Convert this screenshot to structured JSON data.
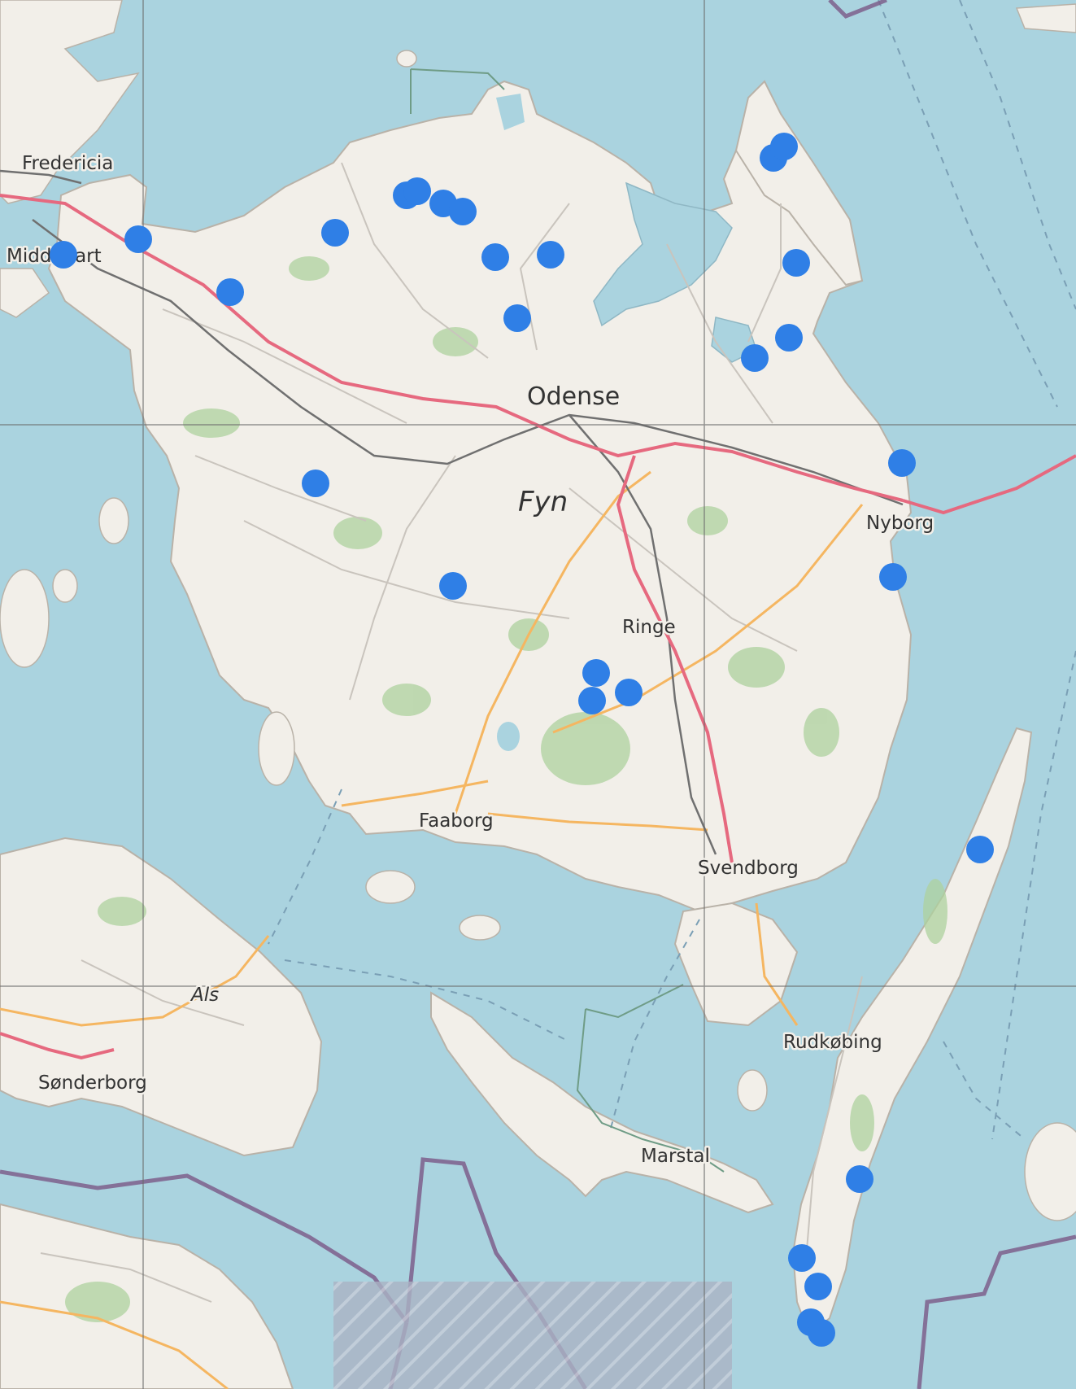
{
  "colors": {
    "water": "#aad3df",
    "land": "#f2efe9",
    "vegetation": "#add19e",
    "motorway": "#e6697f",
    "primary_road": "#f5b661",
    "minor_road": "#c9c4bd",
    "railway": "#707070",
    "boundary": "#7e5f8c",
    "ferry": "#7a9fb5",
    "grid_line": "#6b6b6b",
    "marker": "#2f7fe6"
  },
  "places": [
    {
      "id": "fredericia",
      "label": "Fredericia"
    },
    {
      "id": "middelfart",
      "label": "Middelfart"
    },
    {
      "id": "odense",
      "label": "Odense"
    },
    {
      "id": "fyn",
      "label": "Fyn"
    },
    {
      "id": "nyborg",
      "label": "Nyborg"
    },
    {
      "id": "ringe",
      "label": "Ringe"
    },
    {
      "id": "faaborg",
      "label": "Faaborg"
    },
    {
      "id": "svendborg",
      "label": "Svendborg"
    },
    {
      "id": "als",
      "label": "Als"
    },
    {
      "id": "sonderborg",
      "label": "Sønderborg"
    },
    {
      "id": "rudkobing",
      "label": "Rudkøbing"
    },
    {
      "id": "marstal",
      "label": "Marstal"
    }
  ]
}
